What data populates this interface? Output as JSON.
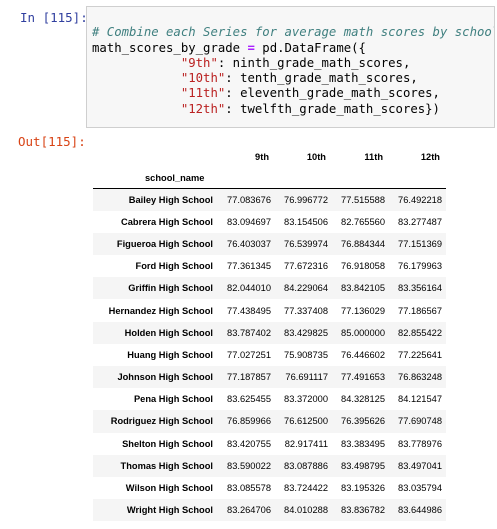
{
  "input_prompt": "In [115]:",
  "output_prompt": "Out[115]:",
  "code": {
    "comment": "# Combine each Series for average math scores by school",
    "line2_var": "math_scores_by_grade ",
    "line2_op": "=",
    "line2_rest": " pd.DataFrame({",
    "entries": [
      {
        "key": "\"9th\"",
        "value": ": ninth_grade_math_scores,"
      },
      {
        "key": "\"10th\"",
        "value": ": tenth_grade_math_scores,"
      },
      {
        "key": "\"11th\"",
        "value": ": eleventh_grade_math_scores,"
      },
      {
        "key": "\"12th\"",
        "value": ": twelfth_grade_math_scores})"
      }
    ],
    "last_line": "math_scores_by_grade"
  },
  "table": {
    "index_name": "school_name",
    "columns": [
      "9th",
      "10th",
      "11th",
      "12th"
    ],
    "rows": [
      {
        "name": "Bailey High School",
        "values": [
          "77.083676",
          "76.996772",
          "77.515588",
          "76.492218"
        ]
      },
      {
        "name": "Cabrera High School",
        "values": [
          "83.094697",
          "83.154506",
          "82.765560",
          "83.277487"
        ]
      },
      {
        "name": "Figueroa High School",
        "values": [
          "76.403037",
          "76.539974",
          "76.884344",
          "77.151369"
        ]
      },
      {
        "name": "Ford High School",
        "values": [
          "77.361345",
          "77.672316",
          "76.918058",
          "76.179963"
        ]
      },
      {
        "name": "Griffin High School",
        "values": [
          "82.044010",
          "84.229064",
          "83.842105",
          "83.356164"
        ]
      },
      {
        "name": "Hernandez High School",
        "values": [
          "77.438495",
          "77.337408",
          "77.136029",
          "77.186567"
        ]
      },
      {
        "name": "Holden High School",
        "values": [
          "83.787402",
          "83.429825",
          "85.000000",
          "82.855422"
        ]
      },
      {
        "name": "Huang High School",
        "values": [
          "77.027251",
          "75.908735",
          "76.446602",
          "77.225641"
        ]
      },
      {
        "name": "Johnson High School",
        "values": [
          "77.187857",
          "76.691117",
          "77.491653",
          "76.863248"
        ]
      },
      {
        "name": "Pena High School",
        "values": [
          "83.625455",
          "83.372000",
          "84.328125",
          "84.121547"
        ]
      },
      {
        "name": "Rodriguez High School",
        "values": [
          "76.859966",
          "76.612500",
          "76.395626",
          "77.690748"
        ]
      },
      {
        "name": "Shelton High School",
        "values": [
          "83.420755",
          "82.917411",
          "83.383495",
          "83.778976"
        ]
      },
      {
        "name": "Thomas High School",
        "values": [
          "83.590022",
          "83.087886",
          "83.498795",
          "83.497041"
        ]
      },
      {
        "name": "Wilson High School",
        "values": [
          "83.085578",
          "83.724422",
          "83.195326",
          "83.035794"
        ]
      },
      {
        "name": "Wright High School",
        "values": [
          "83.264706",
          "84.010288",
          "83.836782",
          "83.644986"
        ]
      }
    ]
  }
}
